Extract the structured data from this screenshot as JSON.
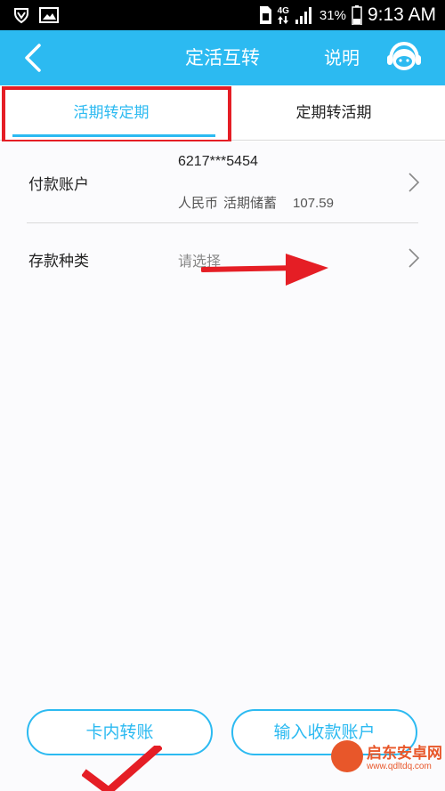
{
  "status_bar": {
    "network": "4G",
    "battery_percent": "31%",
    "time": "9:13 AM"
  },
  "header": {
    "title": "定活互转",
    "help_label": "说明"
  },
  "tabs": [
    {
      "label": "活期转定期",
      "active": true
    },
    {
      "label": "定期转活期",
      "active": false
    }
  ],
  "payment_account": {
    "label": "付款账户",
    "account_number": "6217***5454",
    "currency": "人民币",
    "account_type": "活期储蓄",
    "balance": "107.59"
  },
  "deposit_type": {
    "label": "存款种类",
    "placeholder": "请选择"
  },
  "actions": {
    "in_card_transfer": "卡内转账",
    "enter_payee_account": "输入收款账户"
  },
  "watermark": {
    "text": "启东安卓网",
    "url": "www.qdltdq.com"
  },
  "colors": {
    "primary": "#2cbaf1",
    "annotation_red": "#e51e25",
    "watermark_orange": "#e8572a"
  }
}
